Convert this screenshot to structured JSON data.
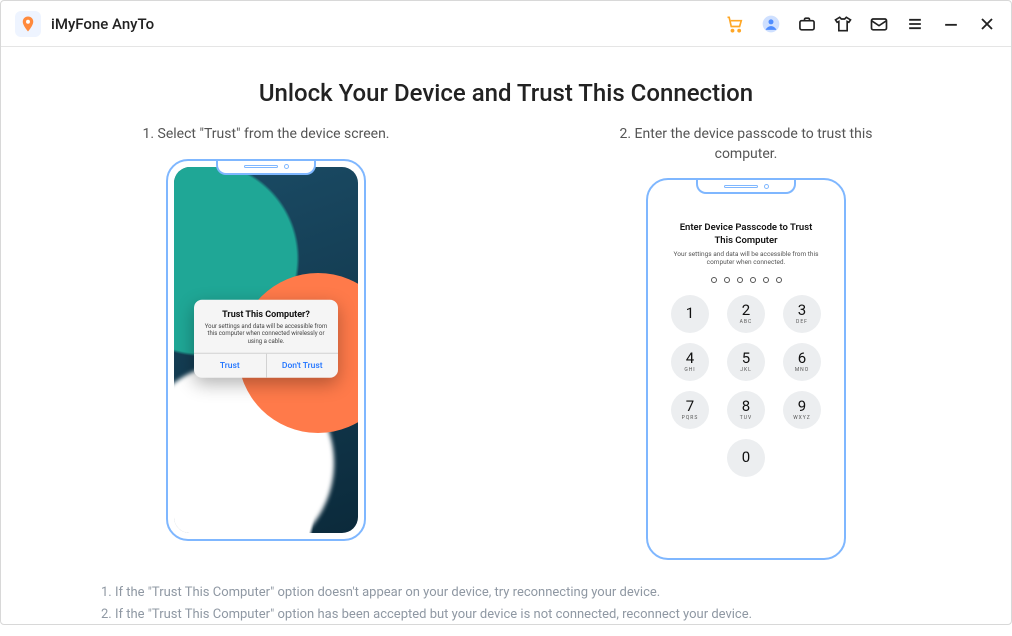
{
  "header": {
    "app_title": "iMyFone AnyTo"
  },
  "page_title": "Unlock Your Device and Trust This Connection",
  "step1": {
    "caption": "1. Select \"Trust\" from the device screen.",
    "dialog_title": "Trust This Computer?",
    "dialog_msg": "Your settings and data will be accessible from this computer when connected wirelessly or using a cable.",
    "trust": "Trust",
    "dont_trust": "Don't Trust"
  },
  "step2": {
    "caption": "2. Enter the device passcode to trust this computer.",
    "screen_title": "Enter Device Passcode to Trust This Computer",
    "screen_sub": "Your settings and data will be accessible from this computer when connected.",
    "keys": [
      {
        "n": "1",
        "l": ""
      },
      {
        "n": "2",
        "l": "ABC"
      },
      {
        "n": "3",
        "l": "DEF"
      },
      {
        "n": "4",
        "l": "GHI"
      },
      {
        "n": "5",
        "l": "JKL"
      },
      {
        "n": "6",
        "l": "MNO"
      },
      {
        "n": "7",
        "l": "PQRS"
      },
      {
        "n": "8",
        "l": "TUV"
      },
      {
        "n": "9",
        "l": "WXYZ"
      },
      {
        "n": "0",
        "l": ""
      }
    ]
  },
  "footnotes": {
    "l1": "1. If the \"Trust This Computer\" option doesn't appear on your device, try reconnecting your device.",
    "l2": "2. If the \"Trust This Computer\" option has been accepted but your device is not connected, reconnect your device."
  }
}
